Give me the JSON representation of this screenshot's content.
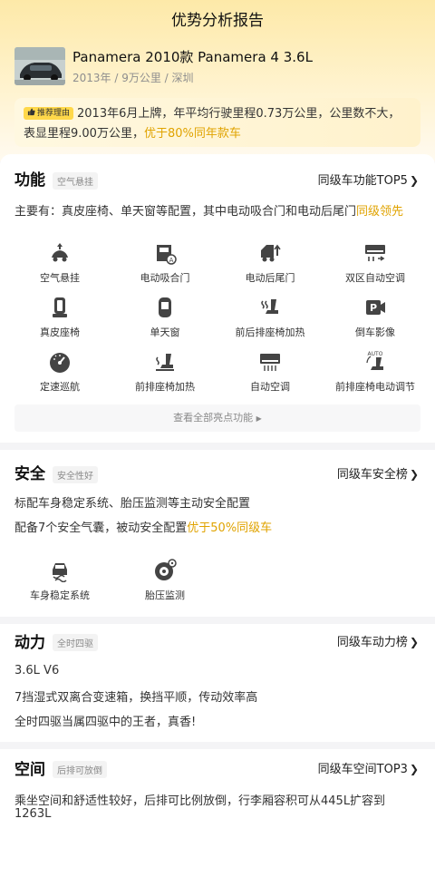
{
  "header": {
    "title": "优势分析报告"
  },
  "car": {
    "name": "Panamera 2010款 Panamera 4 3.6L",
    "meta": "2013年 / 9万公里 / 深圳"
  },
  "reason": {
    "badge": "推荐理由",
    "text": "2013年6月上牌，年平均行驶里程0.73万公里，公里数不大，表显里程9.00万公里，",
    "highlight": "优于80%同年款车"
  },
  "function": {
    "title": "功能",
    "tag": "空气悬挂",
    "link": "同级车功能TOP5",
    "summary": "主要有：真皮座椅、单天窗等配置，其中电动吸合门和电动后尾门",
    "summary_hl": "同级领先",
    "items": [
      {
        "label": "空气悬挂",
        "icon": "air-suspension-icon"
      },
      {
        "label": "电动吸合门",
        "icon": "soft-close-door-icon"
      },
      {
        "label": "电动后尾门",
        "icon": "power-tailgate-icon"
      },
      {
        "label": "双区自动空调",
        "icon": "dual-zone-ac-icon"
      },
      {
        "label": "真皮座椅",
        "icon": "leather-seat-icon"
      },
      {
        "label": "单天窗",
        "icon": "sunroof-icon"
      },
      {
        "label": "前后排座椅加热",
        "icon": "seat-heating-icon"
      },
      {
        "label": "倒车影像",
        "icon": "parking-camera-icon"
      },
      {
        "label": "定速巡航",
        "icon": "cruise-control-icon"
      },
      {
        "label": "前排座椅加热",
        "icon": "front-seat-heating-icon"
      },
      {
        "label": "自动空调",
        "icon": "auto-ac-icon"
      },
      {
        "label": "前排座椅电动调节",
        "icon": "power-seat-adjust-icon"
      }
    ],
    "see_all": "查看全部亮点功能"
  },
  "safety": {
    "title": "安全",
    "tag": "安全性好",
    "link": "同级车安全榜",
    "line1": "标配车身稳定系统、胎压监测等主动安全配置",
    "line2": "配备7个安全气囊，被动安全配置",
    "line2_hl": "优于50%同级车",
    "items": [
      {
        "label": "车身稳定系统",
        "icon": "stability-control-icon"
      },
      {
        "label": "胎压监测",
        "icon": "tire-pressure-icon"
      }
    ]
  },
  "power": {
    "title": "动力",
    "tag": "全时四驱",
    "link": "同级车动力榜",
    "line1": "3.6L V6",
    "line2": "7挡湿式双离合变速箱，换挡平顺，传动效率高",
    "line3": "全时四驱当属四驱中的王者，真香!"
  },
  "space": {
    "title": "空间",
    "tag": "后排可放倒",
    "link": "同级车空间TOP3",
    "line1": "乘坐空间和舒适性较好，后排可比例放倒，行李厢容积可从445L扩容到",
    "line2": "1263L"
  },
  "colors": {
    "accent": "#e0a300",
    "badge": "#ffd84a",
    "icon": "#444444"
  }
}
